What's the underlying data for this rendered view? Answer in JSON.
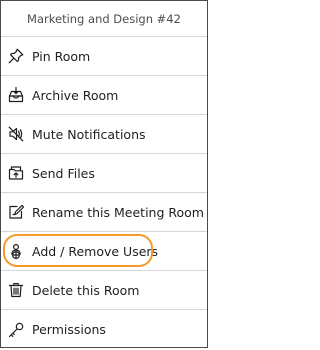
{
  "menu": {
    "header": "Marketing and Design #42",
    "accent_color": "#f39a2a",
    "items": [
      {
        "label": "Pin Room",
        "icon": "pin-icon"
      },
      {
        "label": "Archive Room",
        "icon": "archive-icon"
      },
      {
        "label": "Mute Notifications",
        "icon": "mute-icon"
      },
      {
        "label": "Send Files",
        "icon": "send-files-icon"
      },
      {
        "label": "Rename this Meeting Room",
        "icon": "rename-icon"
      },
      {
        "label": "Add / Remove Users",
        "icon": "add-remove-users-icon",
        "highlighted": true
      },
      {
        "label": "Delete this Room",
        "icon": "trash-icon"
      },
      {
        "label": "Permissions",
        "icon": "key-icon"
      }
    ]
  }
}
